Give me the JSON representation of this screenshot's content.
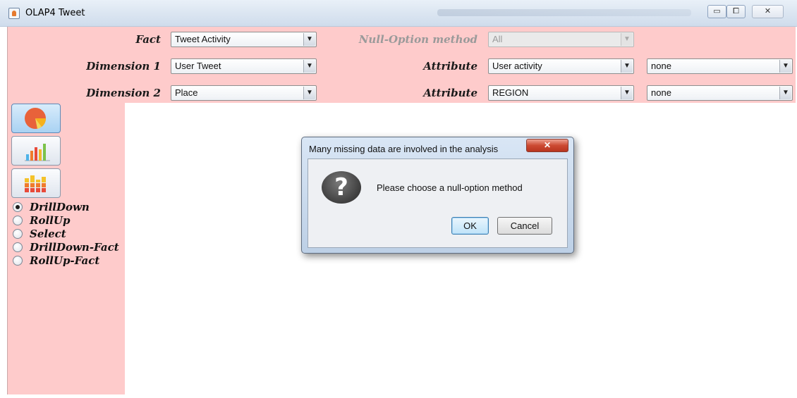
{
  "window": {
    "title": "OLAP4 Tweet",
    "controls": {
      "minimize": "▭",
      "maximize": "⧠",
      "close": "✕"
    }
  },
  "form": {
    "fact": {
      "label": "Fact",
      "value": "Tweet Activity"
    },
    "null_option": {
      "label": "Null-Option method",
      "value": "All"
    },
    "dimension1": {
      "label": "Dimension 1",
      "value": "User Tweet"
    },
    "attribute1": {
      "label": "Attribute",
      "value": "User activity",
      "secondary": "none"
    },
    "dimension2": {
      "label": "Dimension 2",
      "value": "Place"
    },
    "attribute2": {
      "label": "Attribute",
      "value": "REGION",
      "secondary": "none"
    }
  },
  "tools": [
    {
      "icon": "pie-chart-icon",
      "active": true
    },
    {
      "icon": "bar-chart-icon",
      "active": false
    },
    {
      "icon": "stacked-bar-chart-icon",
      "active": false
    }
  ],
  "operations": [
    {
      "label": "DrillDown",
      "checked": true
    },
    {
      "label": "RollUp",
      "checked": false
    },
    {
      "label": "Select",
      "checked": false
    },
    {
      "label": "DrillDown-Fact",
      "checked": false
    },
    {
      "label": "RollUp-Fact",
      "checked": false
    }
  ],
  "dialog": {
    "title": "Many missing data are involved in the analysis",
    "close_glyph": "✕",
    "icon": "question-icon",
    "icon_glyph": "?",
    "message": "Please choose a null-option method",
    "ok_label": "OK",
    "cancel_label": "Cancel"
  },
  "colors": {
    "panel_background": "#fecbcb",
    "active_tool": "#a9d2f3",
    "dialog_close": "#cc4a32"
  }
}
